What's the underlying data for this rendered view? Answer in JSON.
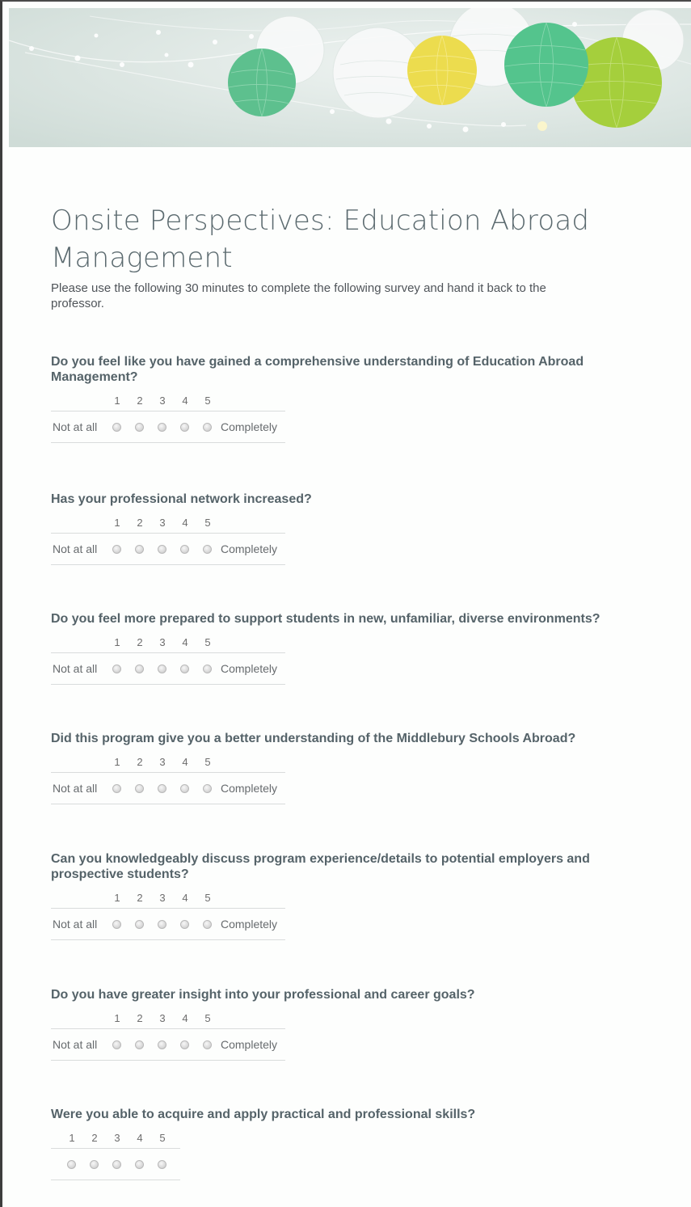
{
  "form": {
    "title_line1": "Onsite Perspectives: Education Abroad",
    "title_line2": "Management",
    "description_line1": "Please use the following 30 minutes to complete the following survey and hand it back to the",
    "description_line2": "professor."
  },
  "scale": {
    "numbers": [
      "1",
      "2",
      "3",
      "4",
      "5"
    ],
    "low_label": "Not at all",
    "high_label": "Completely"
  },
  "questions": [
    {
      "line1": "Do you feel like you have gained a comprehensive understanding of Education Abroad",
      "line2": "Management?"
    },
    {
      "line1": "Has your professional network increased?",
      "line2": ""
    },
    {
      "line1": "Do you feel more prepared to support students in new, unfamiliar, diverse environments?",
      "line2": ""
    },
    {
      "line1": "Did this program give you a better understanding of the Middlebury Schools Abroad?",
      "line2": ""
    },
    {
      "line1": "Can you knowledgeably discuss program experience/details to potential employers and",
      "line2": "prospective students?"
    },
    {
      "line1": "Do you have greater insight into your professional and career goals?",
      "line2": ""
    },
    {
      "line1": "Were you able to acquire and apply practical and professional skills?",
      "line2": ""
    }
  ],
  "colors": {
    "banner_bg": "#dde6e2",
    "lantern_green": "#5dc08e",
    "lantern_yellow": "#ecdc4e",
    "lantern_lime": "#a5cf3c",
    "title_text": "#5b6a6f",
    "question_text": "#556369"
  }
}
